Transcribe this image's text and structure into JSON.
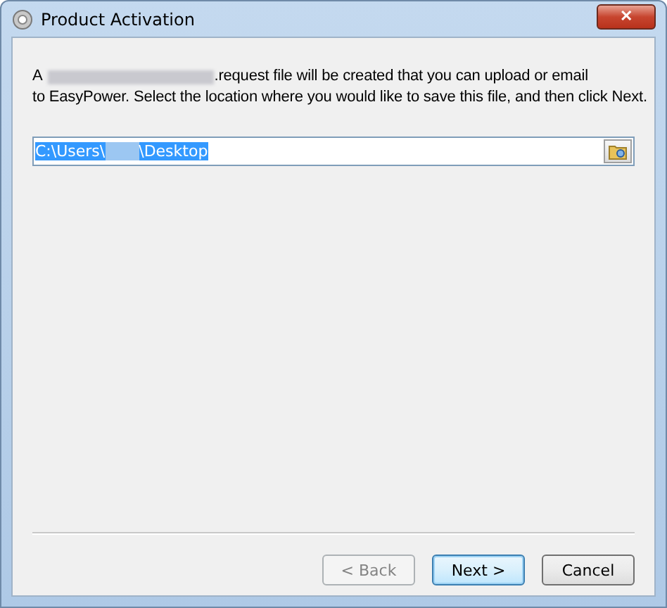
{
  "window": {
    "title": "Product Activation",
    "close_label": "✕"
  },
  "intro": {
    "start": "A",
    "rest": ".request file will be created that you can upload or email",
    "line_2": "to EasyPower. Select the location where you would like to save this file, and then click Next."
  },
  "location_field": {
    "before": "C:\\Users\\",
    "after": "\\Desktop",
    "selected": true
  },
  "buttons": [
    {
      "label": "< Back",
      "disabled": true,
      "default": false
    },
    {
      "label": "Next >",
      "disabled": false,
      "default": true
    },
    {
      "label": "Cancel",
      "disabled": false,
      "default": false
    }
  ]
}
